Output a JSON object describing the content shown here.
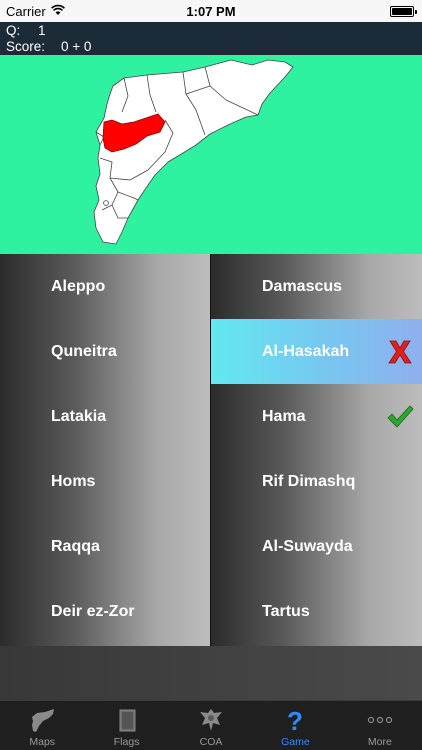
{
  "status_bar": {
    "carrier": "Carrier",
    "time": "1:07 PM"
  },
  "header": {
    "q_label": "Q:",
    "q_value": "1",
    "score_label": "Score:",
    "score_value": "0 + 0"
  },
  "map": {
    "land_color": "#ffffff",
    "highlight_color": "#ff0000",
    "background_color": "#2ef2a0"
  },
  "answers": {
    "left": [
      {
        "label": "Aleppo"
      },
      {
        "label": "Quneitra"
      },
      {
        "label": "Latakia"
      },
      {
        "label": "Homs"
      },
      {
        "label": "Raqqa"
      },
      {
        "label": "Deir ez-Zor"
      }
    ],
    "right": [
      {
        "label": "Damascus"
      },
      {
        "label": "Al-Hasakah",
        "state": "wrong",
        "icon": "red-x-icon"
      },
      {
        "label": "Hama",
        "state": "correct",
        "icon": "green-check-icon"
      },
      {
        "label": "Rif Dimashq"
      },
      {
        "label": "Al-Suwayda"
      },
      {
        "label": "Tartus"
      }
    ]
  },
  "tab_bar": {
    "tabs": [
      {
        "label": "Maps",
        "icon": "map-silhouette-icon"
      },
      {
        "label": "Flags",
        "icon": "flag-book-icon"
      },
      {
        "label": "COA",
        "icon": "coat-of-arms-icon"
      },
      {
        "label": "Game",
        "icon": "question-mark-icon",
        "active": true
      },
      {
        "label": "More",
        "icon": "more-dots-icon"
      }
    ]
  },
  "colors": {
    "accent": "#2f8cff",
    "wrong": "#e02020",
    "correct": "#2fa52f"
  }
}
